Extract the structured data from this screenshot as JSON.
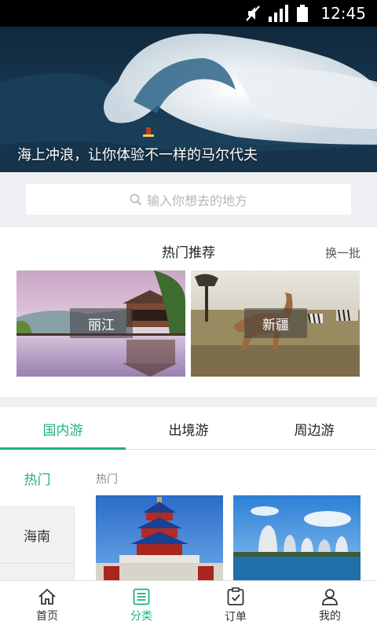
{
  "status_bar": {
    "time": "12:45",
    "icons": [
      "mute-icon",
      "signal-icon",
      "battery-icon"
    ]
  },
  "banner": {
    "caption": "海上冲浪，让你体验不一样的马尔代夫"
  },
  "search": {
    "placeholder": "输入你想去的地方"
  },
  "hot": {
    "title": "热门推荐",
    "refresh_label": "换一批",
    "cards": [
      {
        "label": "丽江"
      },
      {
        "label": "新疆"
      }
    ]
  },
  "tabs": [
    {
      "label": "国内游",
      "active": true
    },
    {
      "label": "出境游",
      "active": false
    },
    {
      "label": "周边游",
      "active": false
    }
  ],
  "side": {
    "items": [
      {
        "label": "热门"
      },
      {
        "label": "海南"
      }
    ]
  },
  "content": {
    "label": "热门"
  },
  "nav": {
    "items": [
      {
        "label": "首页"
      },
      {
        "label": "分类"
      },
      {
        "label": "订单"
      },
      {
        "label": "我的"
      }
    ]
  },
  "colors": {
    "accent": "#23b07e"
  }
}
